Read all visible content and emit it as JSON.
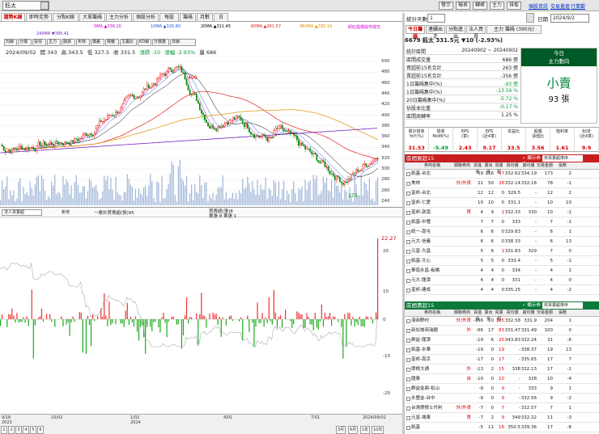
{
  "top": {
    "symbol": "鈺太",
    "buttons": [
      "警示",
      "報表",
      "轉帳",
      "主力",
      "排板"
    ],
    "links": [
      "個股資訊",
      "交易量進",
      "行業觀",
      "影視播映"
    ]
  },
  "tabs": [
    "趨勢K線",
    "即時走勢",
    "分點K線",
    "大單籌碼",
    "主力分析",
    "個股分析",
    "每股",
    "籌碼",
    "月數",
    "日"
  ],
  "ma": [
    {
      "t": "5MA ▲336.20",
      "c": "#c000c0"
    },
    {
      "t": "10MA ▲326.60",
      "c": "#2060d0"
    },
    {
      "t": "20MA ▲311.45",
      "c": "#000000"
    },
    {
      "t": "60MA ▲361.57",
      "c": "#e02020"
    },
    {
      "t": "480MA ▲335.19",
      "c": "#e09000"
    },
    {
      "t": "卸紅盤價操作成交",
      "c": "#d000d0"
    },
    {
      "t": "240MA ▼395.41",
      "c": "#7020c0"
    }
  ],
  "toolbar": [
    "均線",
    "分價",
    "投信",
    "主力",
    "融資",
    "布林",
    "價差",
    "標籤",
    "主籌比",
    "KD線",
    "分價量",
    "日線"
  ],
  "ohlc": {
    "date": "2024/09/02",
    "open": "開 343",
    "high": "高 343.5",
    "low": "低 327.5",
    "close": "收 331.5",
    "chg": "漲跌 -10",
    "pct": "漲幅 -2.93%",
    "vol": "量 686"
  },
  "priceAxis": [
    "500",
    "480",
    "460",
    "440",
    "420",
    "400",
    "380",
    "360",
    "340",
    "320",
    "300",
    "280",
    "260",
    "240"
  ],
  "hiMark": "499",
  "loMark": "273",
  "panel": {
    "sel": "法人買賣超",
    "add": "新增",
    "l1": "一單計買賣超(張)95",
    "l2": "買賣超(張)8",
    "l3": "賣張 8 賣張 1",
    "val": "22.27"
  },
  "lowerAxis": [
    "20",
    "10",
    "0",
    "-10",
    "-20"
  ],
  "dates": [
    "9/18\n2023",
    "10/02",
    "1/02\n2024",
    "4/01",
    "7/01",
    "2024/09/02"
  ],
  "nav": [
    "1",
    "2",
    "3",
    "4",
    "5",
    "6"
  ],
  "ranges": [
    "3月",
    "6月",
    "1年",
    "10年"
  ],
  "right": {
    "days_label": "統計天數",
    "days_val": "1",
    "date_label": "日期",
    "date_val": "2024/9/2",
    "tabs": [
      "今日籌碼",
      "連續出走",
      "分點進出",
      "法人買賣",
      "主力 籌碼 (390元)"
    ],
    "title": "6679 鈺太  331.5元  ▼10 (-2.93%)",
    "summary": [
      [
        "統計區間",
        "20240902 ~ 20240902"
      ],
      [
        "區間成交量",
        "686 張"
      ],
      [
        "買超前15名合計",
        "263 張"
      ],
      [
        "賣超前15名合計",
        "-356 張"
      ],
      [
        "1日籌碼集中(%)",
        "-93 張"
      ],
      [
        "1日籌碼集中(%)",
        "-13.56 %"
      ],
      [
        "20日籌碼集中(%)",
        "-5.72 %"
      ],
      [
        "佔股本比重",
        "-0.17 %"
      ],
      [
        "區間周轉率",
        "1.25 %"
      ]
    ],
    "todayHead": "今日\n主力動向",
    "todayA": "小賣",
    "todayB": "93 張",
    "fin": [
      [
        "累計營收\nYoY(%)",
        "31.53"
      ],
      [
        "營收\nMoM(%)",
        "-5.49"
      ],
      [
        "EPS\n(季)",
        "2.43"
      ],
      [
        "EPS\n(近4季)",
        "9.17"
      ],
      [
        "本益比",
        "33.5"
      ],
      [
        "股價\n淨值比",
        "3.56"
      ],
      [
        "殖利率",
        "1.61"
      ],
      [
        "ROE\n(近4季)",
        "9.9"
      ]
    ],
    "buyHead": "區間買超15",
    "sellHead": "區間賣超15",
    "chk": "✓ 顯示券商",
    "selOpt": "依買賣超排序",
    "cols": [
      "券商名稱",
      "關聯券商",
      "買進張",
      "賣出張",
      "買賣超",
      "買均價",
      "賣均價",
      "交易金額",
      "張數"
    ],
    "buy": [
      [
        "凱基-台北",
        "",
        "59",
        "116",
        "57",
        "332.62",
        "334.19",
        "173",
        "2"
      ],
      [
        "美林",
        "外/外資",
        "22",
        "50",
        "28",
        "332.14",
        "332.18",
        "78",
        "-1"
      ],
      [
        "富邦-台北",
        "",
        "12",
        "12",
        "0",
        "329.5",
        "-",
        "12",
        "2"
      ],
      [
        "富邦-仁愛",
        "",
        "10",
        "10",
        "0",
        "331.1",
        "-",
        "10",
        "10"
      ],
      [
        "富邦-敦南",
        "買",
        "4",
        "9",
        "1",
        "332.33",
        "330",
        "10",
        "-1"
      ],
      [
        "凱基-中壢",
        "",
        "7",
        "7",
        "0",
        "333",
        "-",
        "7",
        "-1"
      ],
      [
        "統一-南屯",
        "",
        "6",
        "6",
        "0",
        "329.83",
        "-",
        "6",
        "1"
      ],
      [
        "元大-信義",
        "",
        "6",
        "6",
        "0",
        "338.33",
        "-",
        "6",
        "13"
      ],
      [
        "元富-大昌",
        "",
        "5",
        "6",
        "1",
        "331.83",
        "329",
        "7",
        "0"
      ],
      [
        "凱基-文心",
        "",
        "5",
        "5",
        "0",
        "333.4",
        "-",
        "5",
        "-1"
      ],
      [
        "華南永昌-板橋",
        "",
        "4",
        "4",
        "0",
        "334",
        "-",
        "4",
        "1"
      ],
      [
        "元大-龍潭",
        "",
        "4",
        "4",
        "0",
        "331",
        "-",
        "4",
        "0"
      ],
      [
        "富邦-建成",
        "",
        "4",
        "4",
        "0",
        "335.25",
        "-",
        "4",
        "-2"
      ]
    ],
    "sell": [
      [
        "港商野村",
        "外/外資",
        "-166",
        "10",
        "185",
        "332.58",
        "331.9",
        "204",
        "1"
      ],
      [
        "新加坡商瑞銀",
        "外",
        "-66",
        "17",
        "83",
        "331.47",
        "331.49",
        "100",
        "0"
      ],
      [
        "群益-龍潭",
        "",
        "-19",
        "6",
        "25",
        "343.83",
        "332.24",
        "31",
        "-6"
      ],
      [
        "凱基-永華",
        "",
        "-19",
        "0",
        "19",
        "-",
        "338.37",
        "19",
        "13"
      ],
      [
        "富邦-南京",
        "",
        "-17",
        "0",
        "17",
        "-",
        "335.65",
        "17",
        "7"
      ],
      [
        "摩根大通",
        "外",
        "-13",
        "2",
        "15",
        "338",
        "332.13",
        "17",
        "-1"
      ],
      [
        "國泰",
        "自",
        "-10",
        "0",
        "10",
        "-",
        "328",
        "10",
        "-4"
      ],
      [
        "群益金鼎-松山",
        "",
        "-9",
        "0",
        "9",
        "-",
        "333",
        "9",
        "1"
      ],
      [
        "永豐金-台中",
        "",
        "-9",
        "0",
        "9",
        "-",
        "332.56",
        "9",
        "-2"
      ],
      [
        "台灣摩根士丹利",
        "外/外資",
        "-7",
        "0",
        "7",
        "-",
        "332.57",
        "7",
        "1"
      ],
      [
        "元富-城東",
        "買",
        "-7",
        "2",
        "9",
        "349",
        "332.22",
        "11",
        "-3"
      ],
      [
        "凱基",
        "",
        "-5",
        "11",
        "16",
        "350.5",
        "339.36",
        "17",
        "-8"
      ],
      [
        "富邦-竹東",
        "",
        "-3",
        "0",
        "3",
        "-",
        "333.33",
        "3",
        "1"
      ]
    ]
  }
}
